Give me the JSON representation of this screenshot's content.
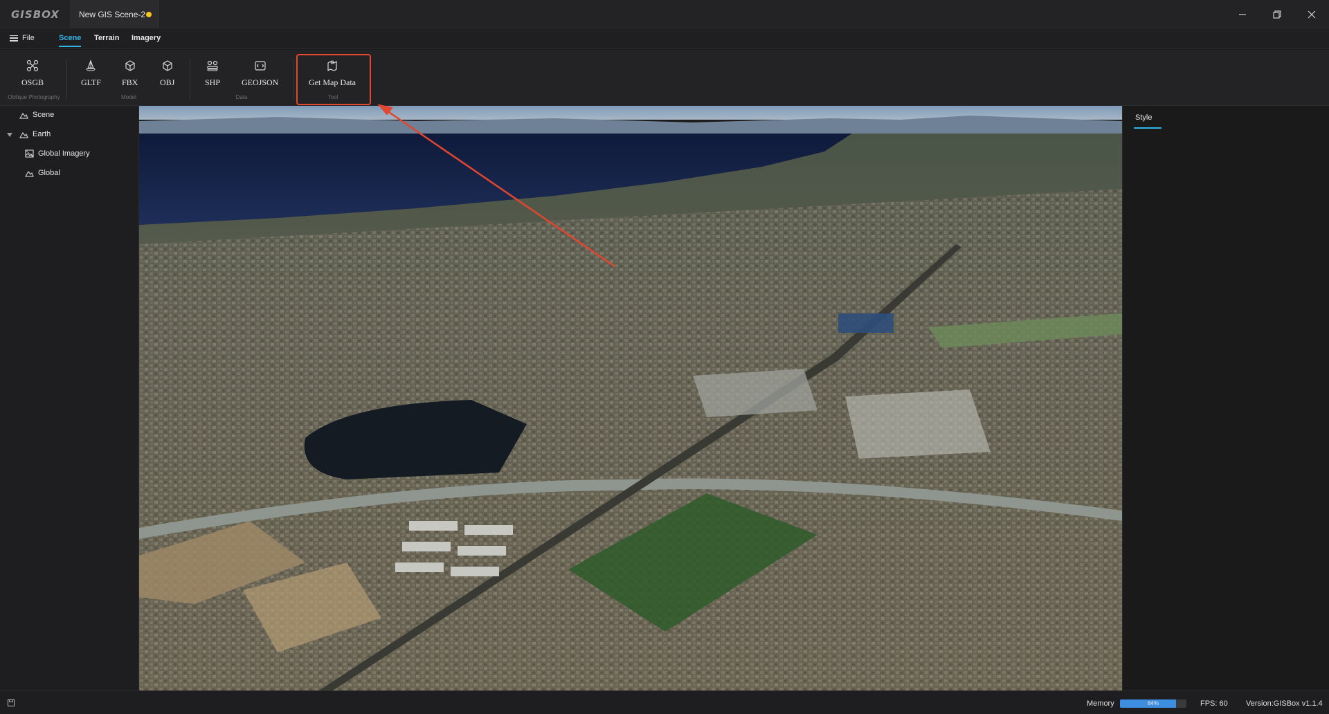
{
  "app": {
    "logo": "GISBOX"
  },
  "document_tab": {
    "title": "New GIS Scene-2",
    "unsaved_color": "#f5c51a"
  },
  "window_controls": {
    "minimize": "—",
    "maximize": "❐",
    "close": "✕"
  },
  "menu": {
    "file": "File",
    "tabs": [
      {
        "label": "Scene",
        "active": true
      },
      {
        "label": "Terrain",
        "active": false
      },
      {
        "label": "Imagery",
        "active": false
      }
    ]
  },
  "ribbon": {
    "buttons": [
      {
        "label": "OSGB",
        "icon": "drone-icon"
      },
      {
        "label": "GLTF",
        "icon": "gltf-model-icon"
      },
      {
        "label": "FBX",
        "icon": "fbx-cube-icon"
      },
      {
        "label": "OBJ",
        "icon": "obj-cube-icon"
      },
      {
        "label": "SHP",
        "icon": "shp-layers-icon"
      },
      {
        "label": "GEOJSON",
        "icon": "geojson-icon"
      },
      {
        "label": "Get Map Data",
        "icon": "map-pin-icon"
      }
    ],
    "groups": [
      "Oblique Photography",
      "Model",
      "Data",
      "Tool"
    ]
  },
  "tree": {
    "items": [
      {
        "label": "Scene",
        "icon": "terrain-icon"
      },
      {
        "label": "Earth",
        "icon": "terrain-icon",
        "expanded": true
      },
      {
        "label": "Global Imagery",
        "icon": "imagery-icon"
      },
      {
        "label": "Global",
        "icon": "terrain-icon"
      }
    ]
  },
  "right_panel": {
    "tab": "Style"
  },
  "status": {
    "memory_label": "Memory",
    "memory_percent": 84,
    "memory_text": "84%",
    "fps": "FPS: 60",
    "version": "Version:GISBox v1.1.4"
  },
  "colors": {
    "accent": "#2fb5e6",
    "annotation": "#e2462f",
    "memory_bar": "#3d8ee0"
  }
}
